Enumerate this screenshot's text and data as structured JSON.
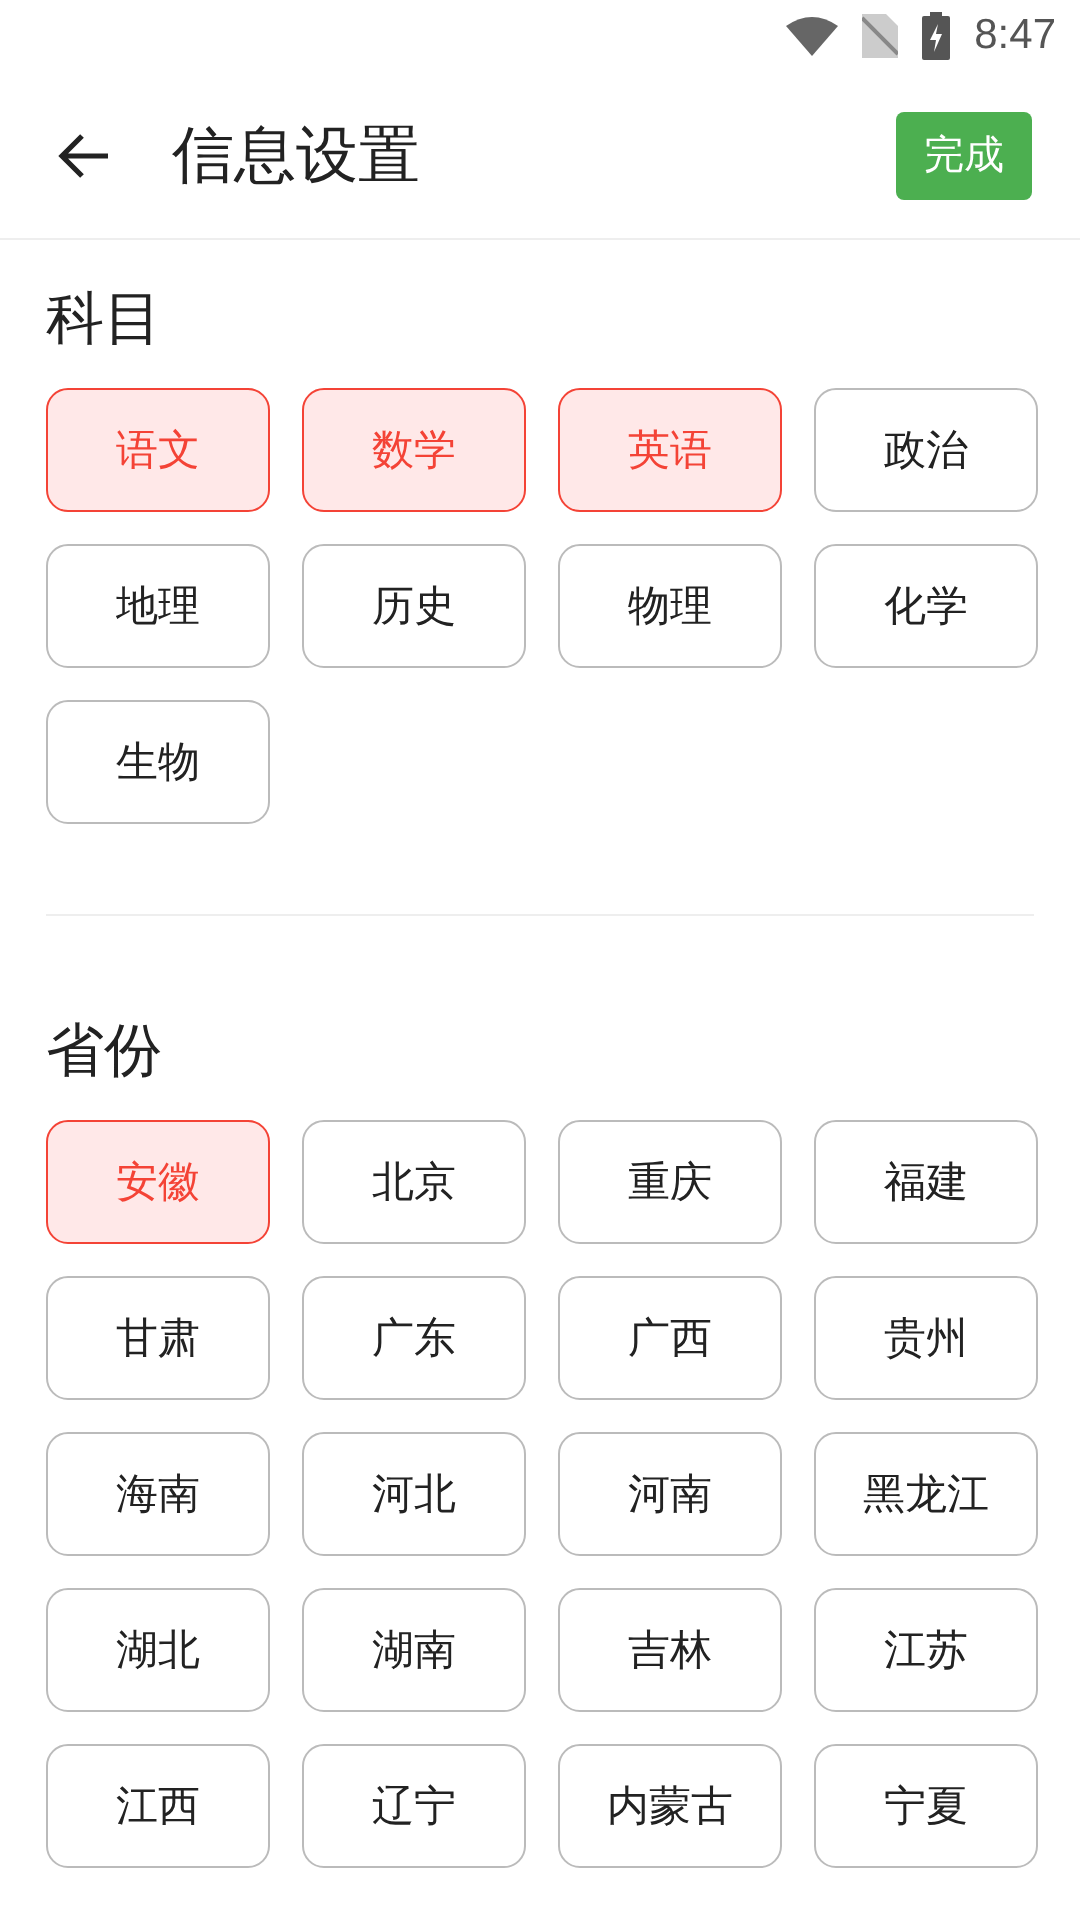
{
  "status_bar": {
    "time": "8:47"
  },
  "header": {
    "title": "信息设置",
    "done_button": "完成"
  },
  "sections": [
    {
      "title": "科目",
      "chips": [
        {
          "label": "语文",
          "selected": true
        },
        {
          "label": "数学",
          "selected": true
        },
        {
          "label": "英语",
          "selected": true
        },
        {
          "label": "政治",
          "selected": false
        },
        {
          "label": "地理",
          "selected": false
        },
        {
          "label": "历史",
          "selected": false
        },
        {
          "label": "物理",
          "selected": false
        },
        {
          "label": "化学",
          "selected": false
        },
        {
          "label": "生物",
          "selected": false
        }
      ]
    },
    {
      "title": "省份",
      "chips": [
        {
          "label": "安徽",
          "selected": true
        },
        {
          "label": "北京",
          "selected": false
        },
        {
          "label": "重庆",
          "selected": false
        },
        {
          "label": "福建",
          "selected": false
        },
        {
          "label": "甘肃",
          "selected": false
        },
        {
          "label": "广东",
          "selected": false
        },
        {
          "label": "广西",
          "selected": false
        },
        {
          "label": "贵州",
          "selected": false
        },
        {
          "label": "海南",
          "selected": false
        },
        {
          "label": "河北",
          "selected": false
        },
        {
          "label": "河南",
          "selected": false
        },
        {
          "label": "黑龙江",
          "selected": false
        },
        {
          "label": "湖北",
          "selected": false
        },
        {
          "label": "湖南",
          "selected": false
        },
        {
          "label": "吉林",
          "selected": false
        },
        {
          "label": "江苏",
          "selected": false
        },
        {
          "label": "江西",
          "selected": false
        },
        {
          "label": "辽宁",
          "selected": false
        },
        {
          "label": "内蒙古",
          "selected": false
        },
        {
          "label": "宁夏",
          "selected": false
        }
      ]
    }
  ]
}
